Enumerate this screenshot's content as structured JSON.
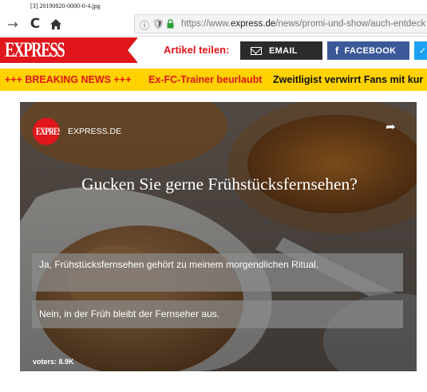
{
  "file_label": "[3] 20190820-0000-0-4.jpg",
  "browser": {
    "back_glyph": "→",
    "reload_glyph": "C",
    "info_glyph": "ⓘ",
    "shield_glyph": "🛡",
    "url_prefix": "https://www.",
    "url_domain": "express.de",
    "url_path": "/news/promi-und-show/auch-entdeck"
  },
  "header": {
    "logo": "EXPRESS",
    "share_label": "Artikel teilen:",
    "email_label": "EMAIL",
    "facebook_glyph": "f",
    "facebook_label": "FACEBOOK",
    "twitter_glyph": "✓",
    "brand_color": "#e0161c"
  },
  "ticker": {
    "breaking": "+++ BREAKING NEWS +++",
    "item1": "Ex-FC-Trainer beurlaubt",
    "item2": "Zweitligist verwirrt Fans mit kur",
    "background": "#ffd200"
  },
  "poll": {
    "avatar_text": "EXPRESS",
    "source": "EXPRESS.DE",
    "share_glyph": "➦",
    "question": "Gucken Sie gerne Frühstücksfernsehen?",
    "options": [
      "Ja, Frühstücksfernsehen gehört zu meinem morgendlichen Ritual.",
      "Nein, in der Früh bleibt der Fernseher aus."
    ],
    "voters": "voters: 8.9K"
  },
  "icons": [
    "back-arrow-icon",
    "reload-icon",
    "home-icon",
    "info-icon",
    "shield-icon",
    "lock-icon",
    "mail-icon",
    "facebook-icon",
    "twitter-icon",
    "share-icon"
  ]
}
